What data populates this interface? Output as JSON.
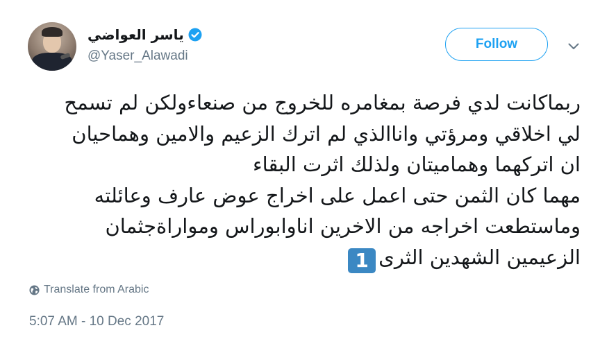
{
  "user": {
    "display_name": "ياسر العواضي",
    "handle": "@Yaser_Alawadi",
    "verified": true
  },
  "follow_label": "Follow",
  "tweet": {
    "lines": [
      "ربماكانت لدي فرصة بمغامره للخروج من صنعاءولكن لم تسمح",
      "لي اخلاقي ومرؤتي واناالذي لم اترك الزعيم والامين وهماحيان",
      "ان اتركهما وهماميتان ولذلك اثرت البقاء",
      "مهما كان الثمن حتى اعمل على اخراج عوض عارف وعائلته",
      "وماستطعت اخراجه من الاخرين اناوابوراس ومواراةجثمان",
      "الزعيمين الشهدين الثرى"
    ],
    "emoji": "1"
  },
  "translate_label": "Translate from Arabic",
  "timestamp": "5:07 AM - 10 Dec 2017",
  "colors": {
    "accent": "#1da1f2",
    "secondary_text": "#657786",
    "emoji_bg": "#3b88c3"
  },
  "icons": {
    "verified": "verified-badge-icon",
    "caret": "chevron-down-icon",
    "translate": "globe-icon"
  }
}
